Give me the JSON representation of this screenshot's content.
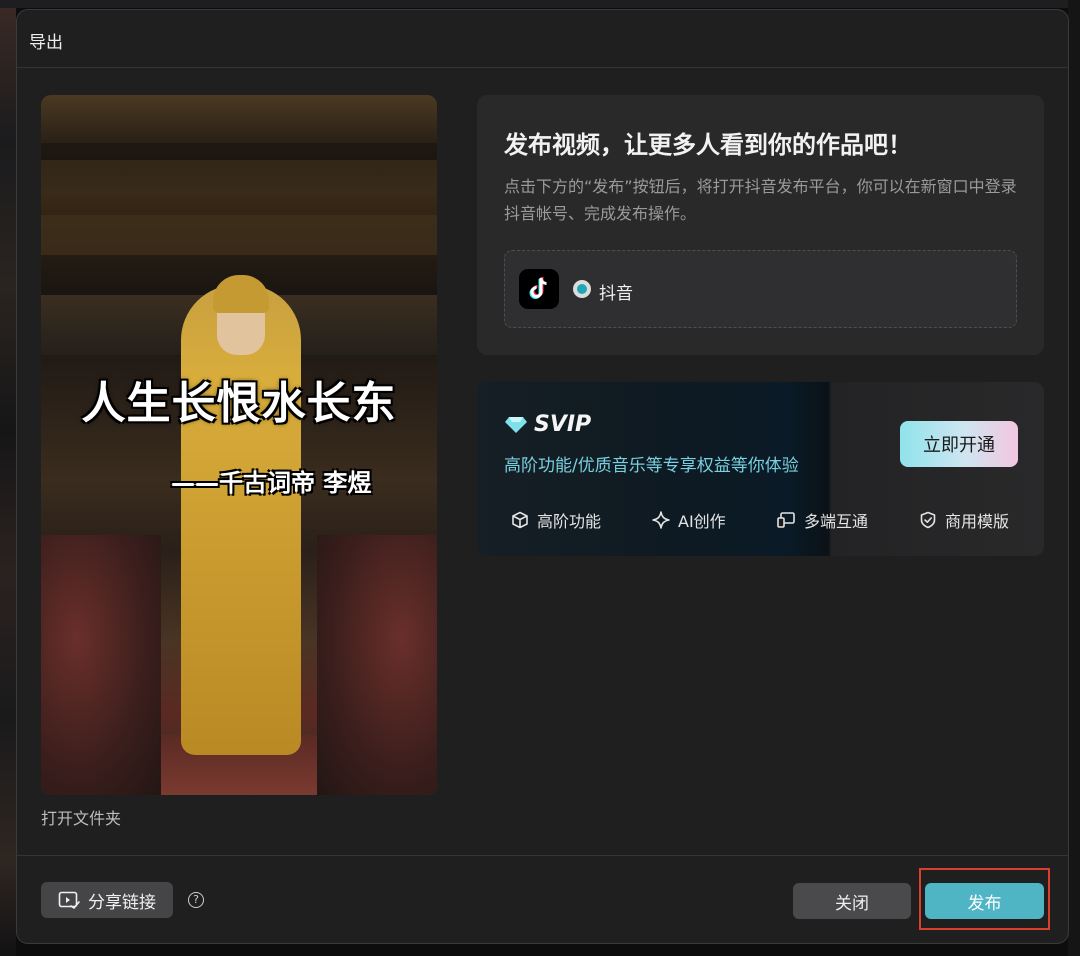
{
  "dialog": {
    "title": "导出"
  },
  "preview": {
    "caption_line1": "人生长恨水长东",
    "caption_line2": "——千古词帝 李煜",
    "open_folder": "打开文件夹"
  },
  "publish_card": {
    "heading": "发布视频，让更多人看到你的作品吧！",
    "description": "点击下方的“发布”按钮后，将打开抖音发布平台，你可以在新窗口中登录抖音帐号、完成发布操作。",
    "platform": {
      "icon": "douyin-logo-icon",
      "label": "抖音",
      "selected": true
    }
  },
  "svip": {
    "icon": "diamond-icon",
    "title": "SVIP",
    "description": "高阶功能/优质音乐等专享权益等你体验",
    "cta": "立即开通",
    "features": [
      {
        "icon": "cube-icon",
        "label": "高阶功能"
      },
      {
        "icon": "sparkle-icon",
        "label": "AI创作"
      },
      {
        "icon": "devices-icon",
        "label": "多端互通"
      },
      {
        "icon": "shield-check-icon",
        "label": "商用模版"
      }
    ]
  },
  "footer": {
    "share_label": "分享链接",
    "share_icon": "share-link-icon",
    "help_icon": "help-icon",
    "close_label": "关闭",
    "publish_label": "发布"
  },
  "colors": {
    "accent": "#4fb5c4",
    "svip_text": "#78d0e0",
    "highlight": "#d8402e"
  }
}
